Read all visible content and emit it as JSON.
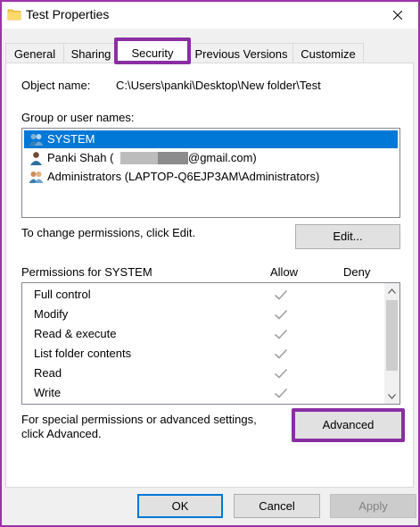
{
  "window": {
    "title": "Test Properties",
    "icon": "folder-icon"
  },
  "tabs": [
    {
      "label": "General",
      "active": false
    },
    {
      "label": "Sharing",
      "active": false
    },
    {
      "label": "Security",
      "active": true
    },
    {
      "label": "Previous Versions",
      "active": false
    },
    {
      "label": "Customize",
      "active": false
    }
  ],
  "security": {
    "object_name_label": "Object name:",
    "object_name_value": "C:\\Users\\panki\\Desktop\\New folder\\Test",
    "group_label": "Group or user names:",
    "groups": [
      {
        "name": "SYSTEM",
        "selected": true,
        "icon": "group-users-icon"
      },
      {
        "name_prefix": "Panki Shah (",
        "name_suffix": "@gmail.com)",
        "selected": false,
        "icon": "user-icon"
      },
      {
        "name": "Administrators (LAPTOP-Q6EJP3AM\\Administrators)",
        "selected": false,
        "icon": "group-users-icon"
      }
    ],
    "change_hint": "To change permissions, click Edit.",
    "edit_button": "Edit...",
    "permissions_label": "Permissions for SYSTEM",
    "allow_header": "Allow",
    "deny_header": "Deny",
    "permissions": [
      {
        "name": "Full control",
        "allow": true,
        "deny": false
      },
      {
        "name": "Modify",
        "allow": true,
        "deny": false
      },
      {
        "name": "Read & execute",
        "allow": true,
        "deny": false
      },
      {
        "name": "List folder contents",
        "allow": true,
        "deny": false
      },
      {
        "name": "Read",
        "allow": true,
        "deny": false
      },
      {
        "name": "Write",
        "allow": true,
        "deny": false
      }
    ],
    "advanced_hint_line1": "For special permissions or advanced settings,",
    "advanced_hint_line2": "click Advanced.",
    "advanced_button": "Advanced"
  },
  "footer": {
    "ok": "OK",
    "cancel": "Cancel",
    "apply": "Apply",
    "apply_enabled": false
  },
  "colors": {
    "highlight_frame": "#8a2ea3",
    "selection": "#0078d7"
  }
}
